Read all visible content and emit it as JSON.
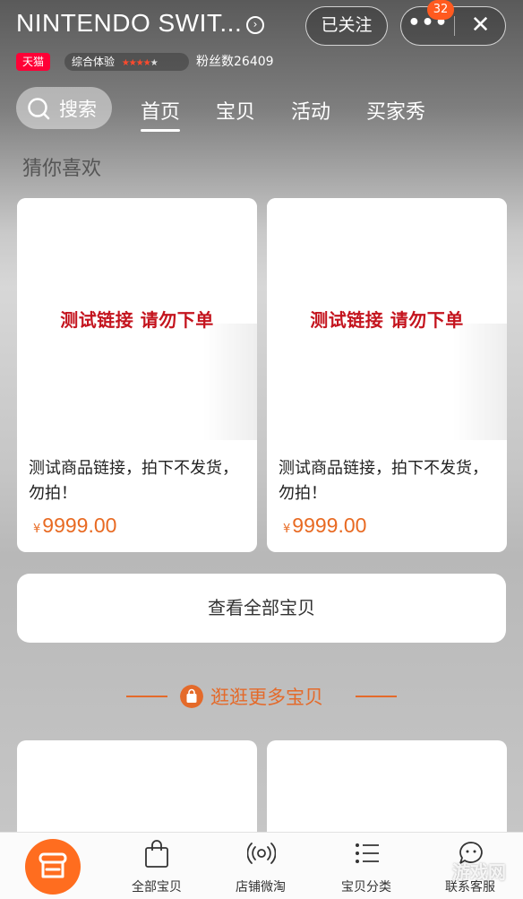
{
  "header": {
    "shop_title": "NINTENDO SWIT...",
    "follow_label": "已关注",
    "more_glyph": "•••",
    "close_glyph": "✕",
    "badge_count": "32",
    "tmall_tag": "天猫",
    "rating_label": "综合体验",
    "fans_label": "粉丝数26409"
  },
  "nav": {
    "search_label": "搜索",
    "tabs": [
      {
        "label": "首页",
        "active": true
      },
      {
        "label": "宝贝",
        "active": false
      },
      {
        "label": "活动",
        "active": false
      },
      {
        "label": "买家秀",
        "active": false
      }
    ]
  },
  "section": {
    "title": "猜你喜欢"
  },
  "products": [
    {
      "banner": "测试链接 请勿下单",
      "name": "测试商品链接，拍下不发货，勿拍！",
      "currency": "¥",
      "price": "9999.00"
    },
    {
      "banner": "测试链接 请勿下单",
      "name": "测试商品链接，拍下不发货，勿拍！",
      "currency": "¥",
      "price": "9999.00"
    }
  ],
  "view_all_label": "查看全部宝贝",
  "more_items_label": "逛逛更多宝贝",
  "tabbar": {
    "items": [
      {
        "label": "全部宝贝",
        "icon": "shopping-bag-icon"
      },
      {
        "label": "店铺微淘",
        "icon": "broadcast-icon"
      },
      {
        "label": "宝贝分类",
        "icon": "list-icon"
      },
      {
        "label": "联系客服",
        "icon": "chat-bubble-icon"
      }
    ]
  },
  "watermark": "游戏网",
  "colors": {
    "accent": "#ff6d1f",
    "price": "#e86a22",
    "tmall": "#ff0036",
    "banner_red": "#c4141e"
  }
}
